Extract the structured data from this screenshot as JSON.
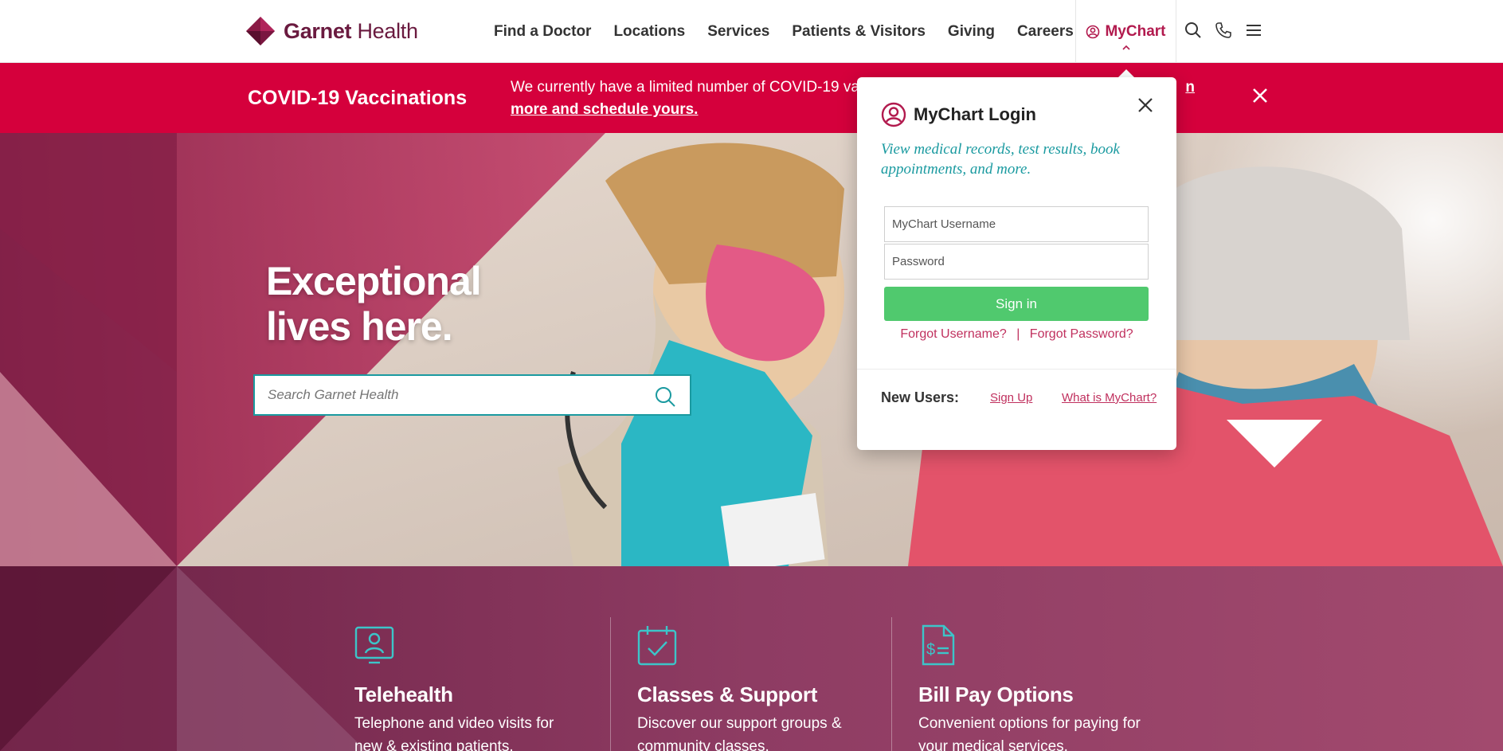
{
  "brand": {
    "name_bold": "Garnet",
    "name_light": "Health",
    "primary_color": "#6a1a3f",
    "accent_color": "#d5003c",
    "teal_color": "#1a9aa0",
    "green_color": "#50c96e"
  },
  "nav": {
    "items": [
      {
        "label": "Find a Doctor"
      },
      {
        "label": "Locations"
      },
      {
        "label": "Services"
      },
      {
        "label": "Patients & Visitors"
      },
      {
        "label": "Giving"
      },
      {
        "label": "Careers"
      }
    ],
    "mychart_label": "MyChart",
    "icons": [
      "search-icon",
      "phone-icon",
      "menu-icon"
    ]
  },
  "alert": {
    "title": "COVID-19 Vaccinations",
    "text": "We currently have a limited number of COVID-19 vac",
    "text_tail": "n",
    "link": "more and schedule yours."
  },
  "hero": {
    "title_line1": "Exceptional",
    "title_line2": "lives here.",
    "search_placeholder": "Search Garnet Health"
  },
  "cards": [
    {
      "icon": "telehealth-icon",
      "title": "Telehealth",
      "desc": "Telephone and video visits for new & existing patients."
    },
    {
      "icon": "calendar-check-icon",
      "title": "Classes & Support",
      "desc": "Discover our support groups & community classes."
    },
    {
      "icon": "bill-icon",
      "title": "Bill Pay Options",
      "desc": "Convenient options for paying for your medical services."
    }
  ],
  "mychart_popup": {
    "title": "MyChart Login",
    "subtitle": "View medical records, test results, book appointments, and more.",
    "username_placeholder": "MyChart Username",
    "password_placeholder": "Password",
    "signin_label": "Sign in",
    "forgot_username": "Forgot Username?",
    "forgot_separator": "|",
    "forgot_password": "Forgot Password?",
    "new_users_label": "New Users:",
    "signup_link": "Sign Up",
    "what_is_link": "What is MyChart?"
  }
}
